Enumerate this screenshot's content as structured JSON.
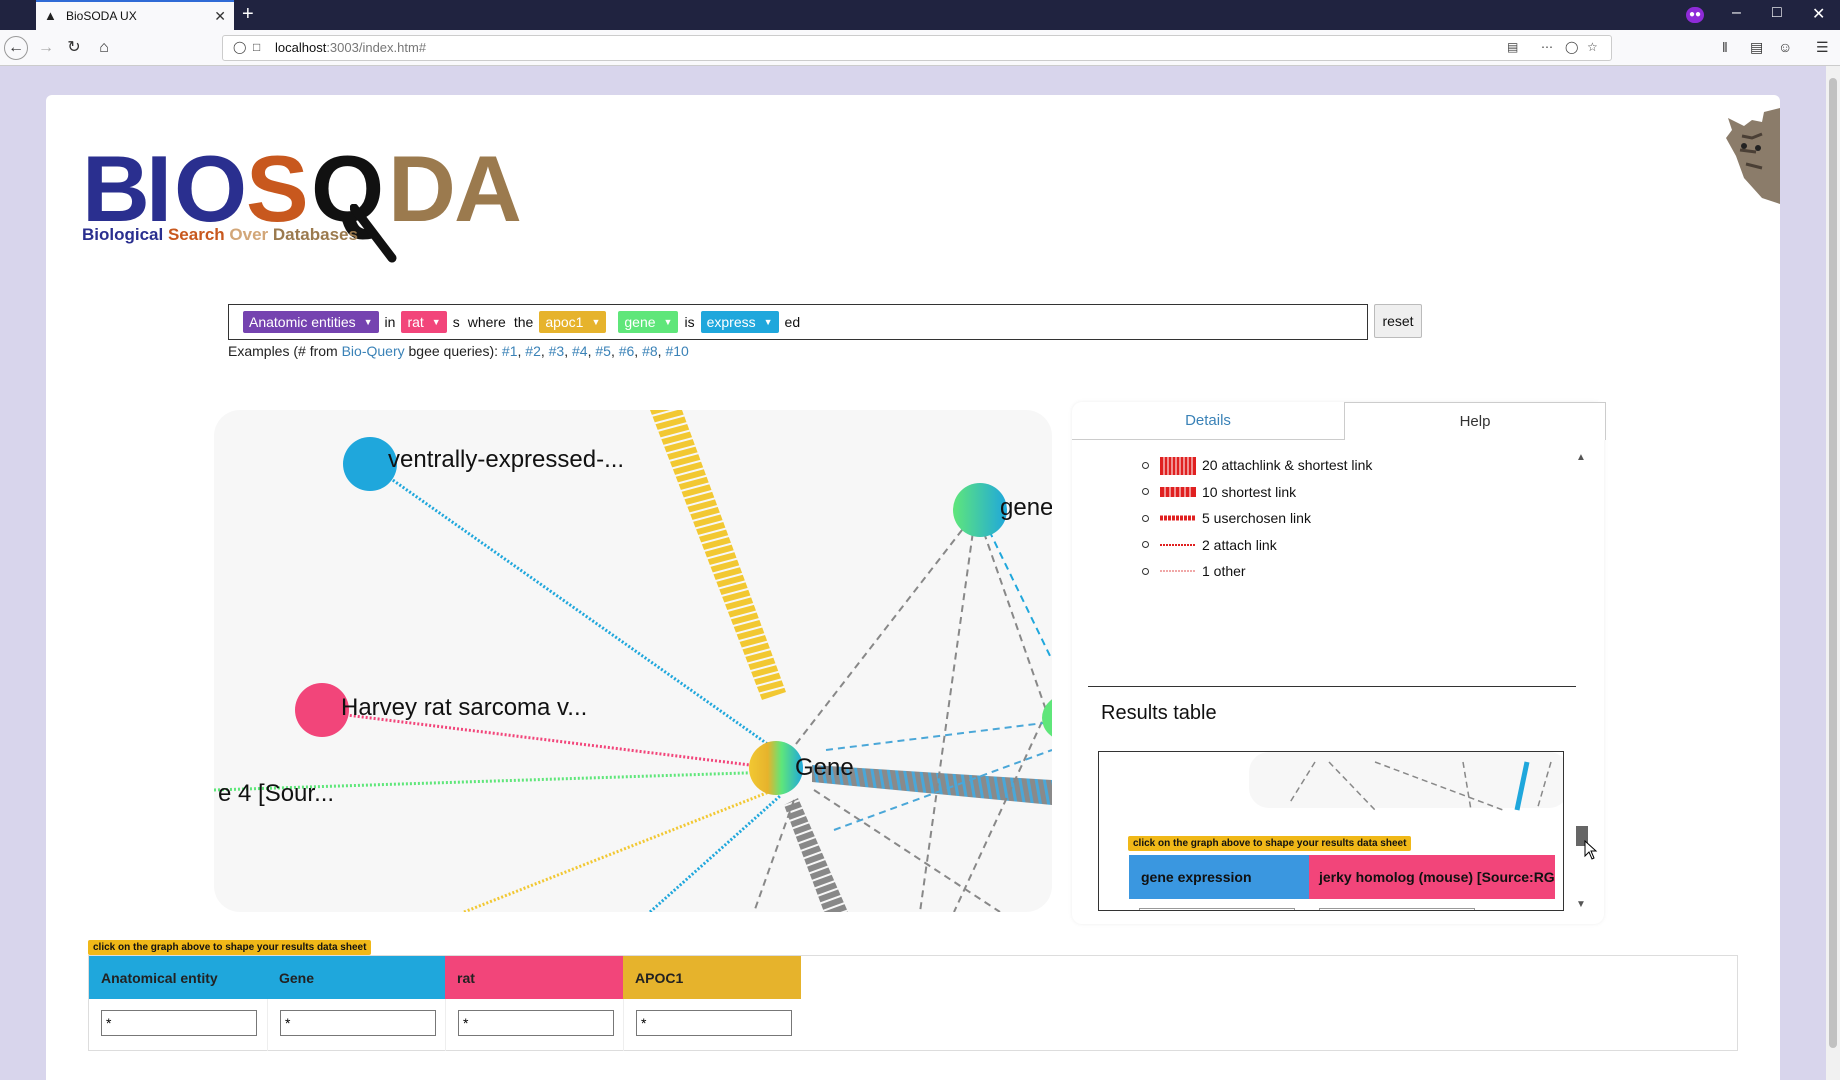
{
  "browser": {
    "tab_title": "BioSODA UX",
    "url_host": "localhost",
    "url_path": ":3003/index.htm#"
  },
  "logo": {
    "letters": [
      "B",
      "I",
      "O",
      "S",
      "Q",
      "D",
      "A"
    ],
    "subtitle_parts": [
      "Biological",
      "Search",
      "Over",
      "Databases"
    ],
    "colors": {
      "blue": "#2a2f8f",
      "orange": "#c8581e",
      "black": "#111111",
      "tan": "#9b7a4e",
      "lighttan": "#d2a678"
    }
  },
  "query": {
    "chip_anatomic": "Anatomic entities",
    "word_in": "in",
    "chip_rat": "rat",
    "word_s": "s",
    "word_where": "where",
    "word_the": "the",
    "chip_apoc1": "apoc1",
    "chip_gene": "gene",
    "word_is": "is",
    "chip_express": "express",
    "word_ed": "ed",
    "reset_label": "reset",
    "colors": {
      "purple": "#7543b0",
      "pink": "#f2457a",
      "gold": "#e6b32c",
      "green": "#5fe67a",
      "cyan": "#1fa7dc"
    }
  },
  "examples": {
    "prefix": "Examples (# from",
    "source_link": "Bio-Query",
    "mid": "bgee queries):",
    "links": [
      "#1",
      "#2",
      "#3",
      "#4",
      "#5",
      "#6",
      "#8",
      "#10"
    ]
  },
  "graph": {
    "labels": {
      "ventrally": "ventrally-expressed-...",
      "gene_right": "gene",
      "harvey": "Harvey rat sarcoma v...",
      "sour": "e 4 [Sour...",
      "center": "Gene"
    }
  },
  "panel": {
    "tab_details": "Details",
    "tab_help": "Help",
    "legend": [
      {
        "label": "20 attachlink & shortest link",
        "kind": "thick"
      },
      {
        "label": "10 shortest link",
        "kind": "medium"
      },
      {
        "label": "5 userchosen link",
        "kind": "thin"
      },
      {
        "label": "2 attach link",
        "kind": "dotted"
      },
      {
        "label": "1 other",
        "kind": "faint"
      }
    ],
    "results_title": "Results table",
    "results_hint": "click on the graph above to shape your results data sheet",
    "results_headers": [
      "gene expression",
      "jerky homolog (mouse) [Source:RGD"
    ]
  },
  "bottom": {
    "hint": "click on the graph above to shape your results data sheet",
    "columns": [
      {
        "header": "Anatomical entity",
        "color": "#1fa7dc",
        "value": "*"
      },
      {
        "header": "Gene",
        "color": "#1fa7dc",
        "value": "*"
      },
      {
        "header": "rat",
        "color": "#f2457a",
        "value": "*"
      },
      {
        "header": "APOC1",
        "color": "#e6b32c",
        "value": "*"
      }
    ]
  }
}
